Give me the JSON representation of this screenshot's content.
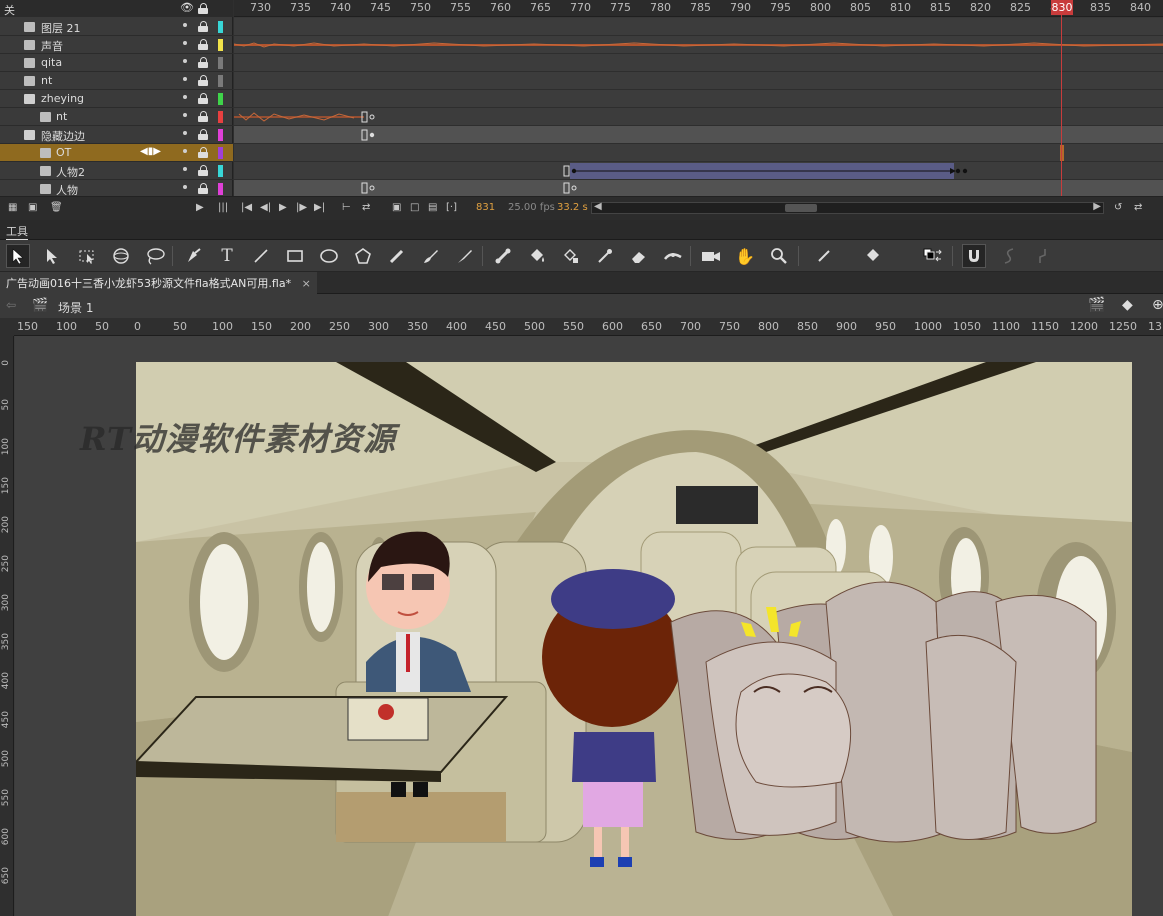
{
  "timeline": {
    "header_label": "关",
    "frame_numbers": [
      "730",
      "735",
      "740",
      "745",
      "750",
      "755",
      "760",
      "765",
      "770",
      "775",
      "780",
      "785",
      "790",
      "795",
      "800",
      "805",
      "810",
      "815",
      "820",
      "825",
      "830",
      "835",
      "840"
    ],
    "playhead_frame": "830",
    "layers": [
      {
        "name": "图层 21",
        "color": "#38d6d6",
        "type": "layer"
      },
      {
        "name": "声音",
        "color": "#f2e34a",
        "type": "layer"
      },
      {
        "name": "qita",
        "color": "#7a7a7a",
        "type": "layer"
      },
      {
        "name": "nt",
        "color": "#7a7a7a",
        "type": "layer"
      },
      {
        "name": "zheying",
        "color": "#3fd44a",
        "type": "folder"
      },
      {
        "name": "nt",
        "color": "#e84040",
        "type": "sub"
      },
      {
        "name": "隐藏边边",
        "color": "#e040d8",
        "type": "folder"
      },
      {
        "name": "OT",
        "color": "#a040d8",
        "type": "sub",
        "selected": true
      },
      {
        "name": "人物2",
        "color": "#38d6d6",
        "type": "sub"
      },
      {
        "name": "人物",
        "color": "#e040d8",
        "type": "sub"
      }
    ],
    "status": {
      "frame": "831",
      "fps": "25.00 fps",
      "time": "33.2 s"
    }
  },
  "tools_panel": {
    "title": "工具"
  },
  "document": {
    "tab_title": "广告动画016十三香小龙虾53秒源文件fla格式AN可用.fla*",
    "close_glyph": "×",
    "scene": "场景 1"
  },
  "hruler_numbers": [
    "150",
    "100",
    "50",
    "0",
    "50",
    "100",
    "150",
    "200",
    "250",
    "300",
    "350",
    "400",
    "450",
    "500",
    "550",
    "600",
    "650",
    "700",
    "750",
    "800",
    "850",
    "900",
    "950",
    "1000",
    "1050",
    "1100",
    "1150",
    "1200",
    "1250",
    "13"
  ],
  "vruler_numbers": [
    "0",
    "50",
    "100",
    "150",
    "200",
    "250",
    "300",
    "350",
    "400",
    "450",
    "500",
    "550",
    "600",
    "650"
  ],
  "stage": {
    "watermark": "RT动漫软件素材资源"
  },
  "icons": {
    "tools": [
      "selection-icon",
      "subselection-icon",
      "free-transform-icon",
      "3d-rotation-icon",
      "lasso-icon",
      "pen-icon",
      "text-icon",
      "line-icon",
      "rectangle-icon",
      "oval-icon",
      "polystar-icon",
      "pencil-icon",
      "paint-brush-icon",
      "brush-icon",
      "bone-icon",
      "paint-bucket-icon",
      "ink-bottle-icon",
      "eyedropper-icon",
      "eraser-icon",
      "width-icon",
      "camera-icon",
      "hand-icon",
      "zoom-icon",
      "stroke-color-icon",
      "fill-color-icon",
      "swap-colors-icon",
      "snap-magnet-icon",
      "smooth-icon",
      "straighten-icon"
    ]
  }
}
